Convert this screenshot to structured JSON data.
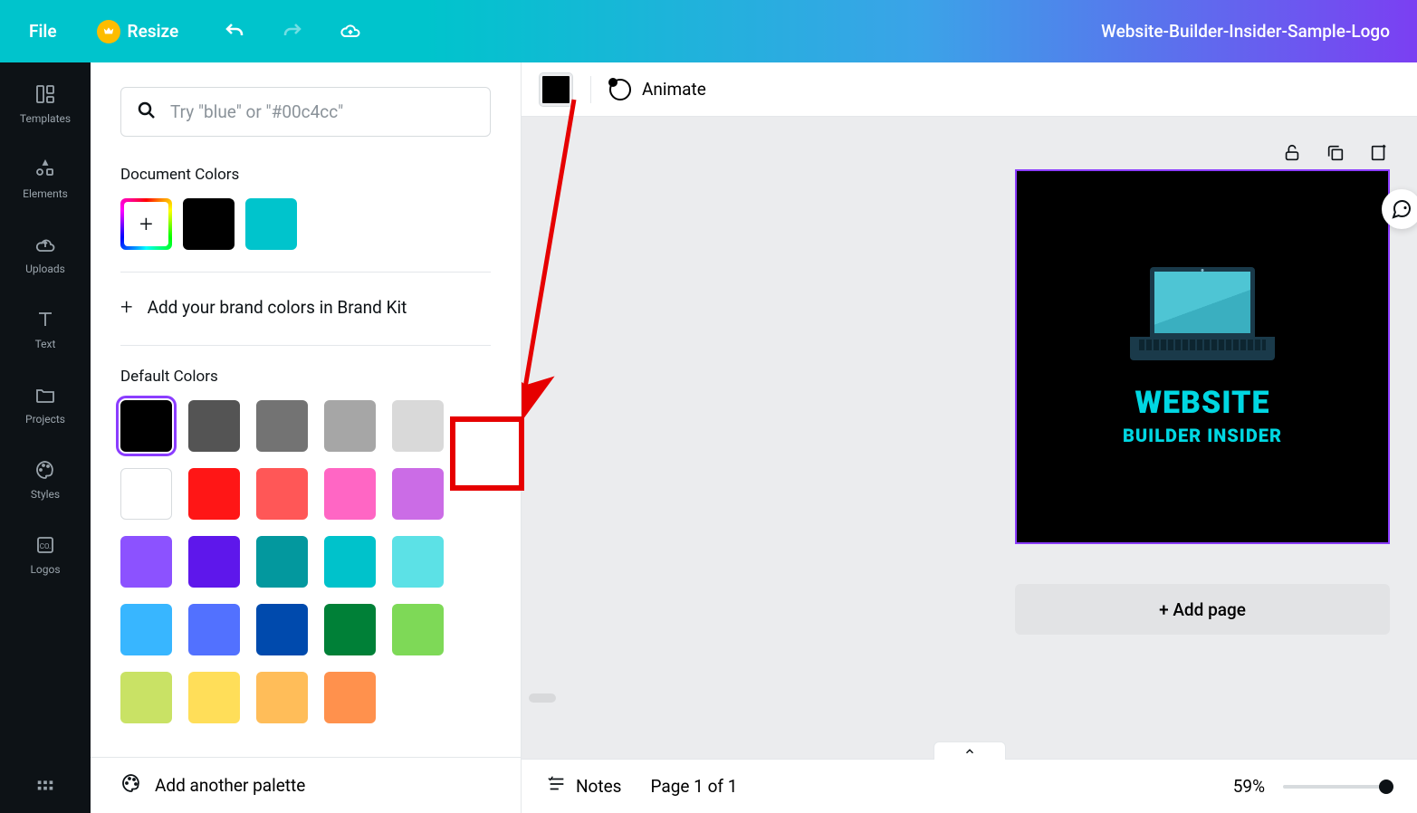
{
  "header": {
    "file": "File",
    "resize": "Resize",
    "doc_title": "Website-Builder-Insider-Sample-Logo"
  },
  "rail": {
    "templates": "Templates",
    "elements": "Elements",
    "uploads": "Uploads",
    "text": "Text",
    "projects": "Projects",
    "styles": "Styles",
    "logos": "Logos"
  },
  "panel": {
    "search_placeholder": "Try \"blue\" or \"#00c4cc\"",
    "doc_colors_label": "Document Colors",
    "doc_colors": [
      "#000000",
      "#00c4cc"
    ],
    "brand_kit_text": "Add your brand colors in Brand Kit",
    "default_label": "Default Colors",
    "default_rows": [
      [
        "#000000",
        "#545454",
        "#737373",
        "#a6a6a6",
        "#d9d9d9",
        "#ffffff"
      ],
      [
        "#ff1616",
        "#ff5757",
        "#ff66c4",
        "#cb6ce6",
        "#8c52ff",
        "#5e17eb"
      ],
      [
        "#03989e",
        "#00c2cb",
        "#5ce1e6",
        "#38b6ff",
        "#5271ff",
        "#004aad"
      ],
      [
        "#008037",
        "#7ed957",
        "#c9e265",
        "#ffde59",
        "#ffbd59",
        "#ff914d"
      ]
    ],
    "selected_default": "#000000",
    "highlighted_white_index": 5,
    "add_palette": "Add another palette"
  },
  "context": {
    "current_color": "#000000",
    "animate": "Animate"
  },
  "canvas": {
    "logo_title": "WEBSITE",
    "logo_sub": "BUILDER INSIDER",
    "add_page": "+ Add page"
  },
  "footer": {
    "notes": "Notes",
    "page_indicator": "Page 1 of 1",
    "zoom": "59%"
  }
}
